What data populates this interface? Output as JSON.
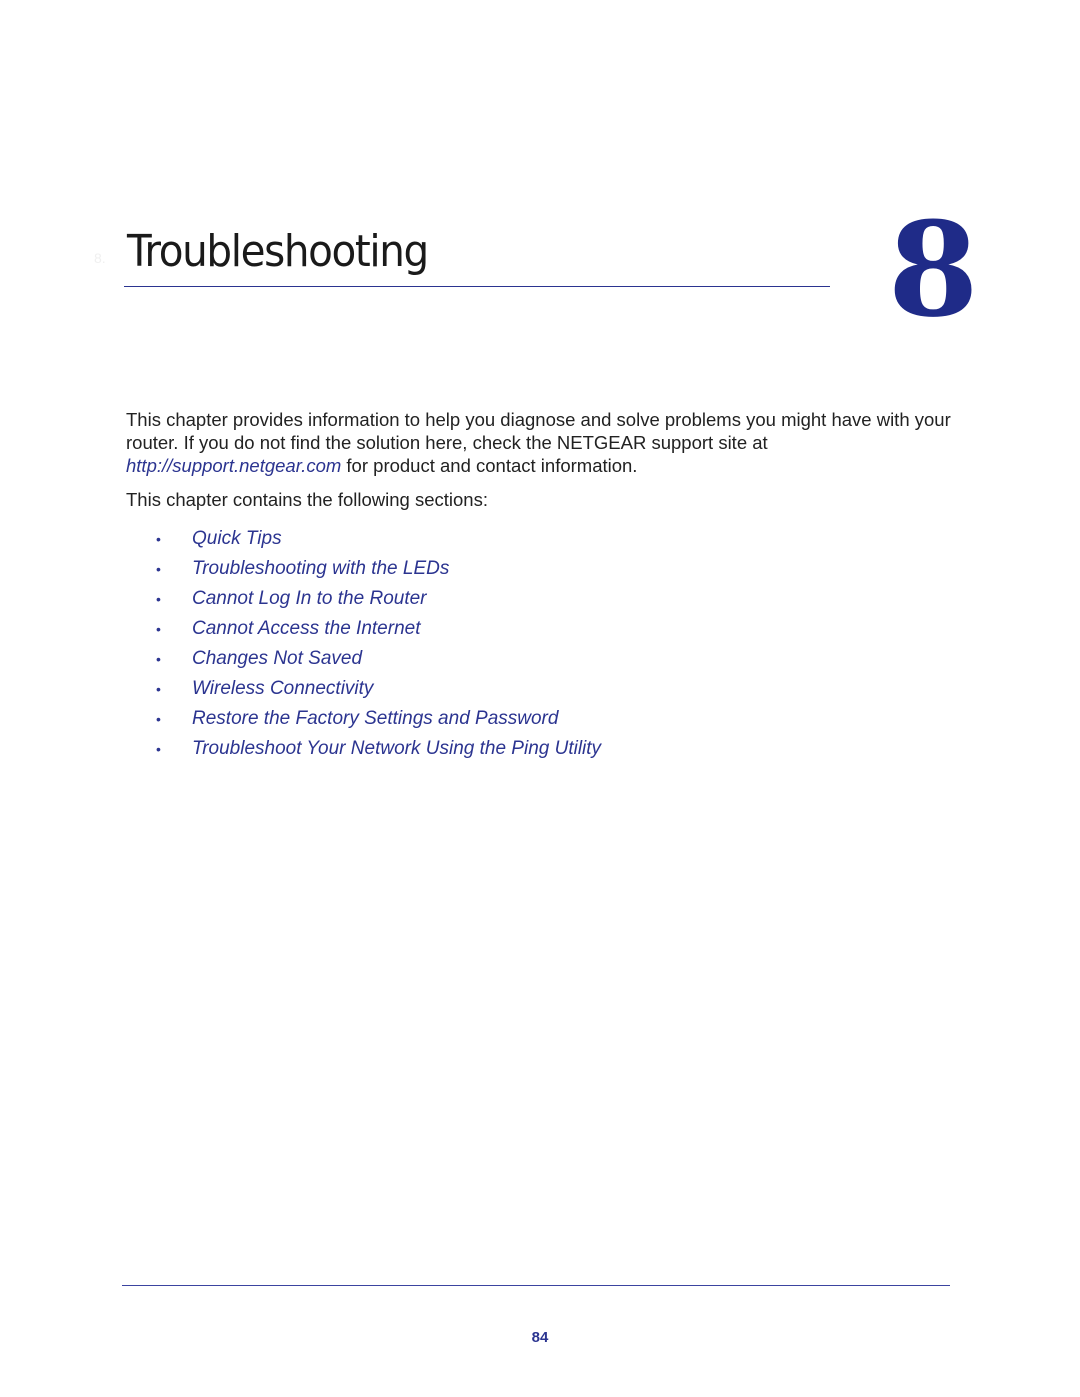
{
  "chapter": {
    "ghost_label": "8.",
    "title": "Troubleshooting",
    "number": "8"
  },
  "intro": {
    "text_before_link": "This chapter provides information to help you diagnose and solve problems you might have with your router. If you do not find the solution here, check the NETGEAR support site at ",
    "link": "http://support.netgear.com",
    "text_after_link": " for product and contact information."
  },
  "sections_intro": "This chapter contains the following sections:",
  "sections": [
    {
      "bullet": "•",
      "label": "Quick Tips"
    },
    {
      "bullet": "•",
      "label": "Troubleshooting with the LEDs"
    },
    {
      "bullet": "•",
      "label": "Cannot Log In to the Router"
    },
    {
      "bullet": "•",
      "label": "Cannot Access the Internet"
    },
    {
      "bullet": "•",
      "label": "Changes Not Saved"
    },
    {
      "bullet": "•",
      "label": "Wireless Connectivity"
    },
    {
      "bullet": "•",
      "label": "Restore the Factory Settings and Password"
    },
    {
      "bullet": "•",
      "label": "Troubleshoot Your Network Using the Ping Utility"
    }
  ],
  "footer": {
    "page_number": "84"
  },
  "colors": {
    "accent": "#2b3490",
    "chapter_number": "#1f2b88"
  }
}
